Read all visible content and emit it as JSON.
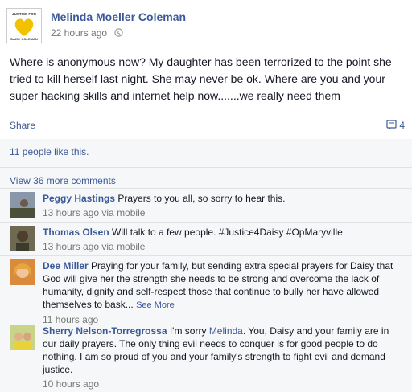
{
  "post": {
    "author": "Melinda Moeller Coleman",
    "avatar_text_top": "JUSTICE FOR",
    "avatar_text_bottom": "DAISY COLEMAN",
    "time": "22 hours ago",
    "text": "Where is anonymous now? My daughter has been terrorized to the point she tried to kill herself last night. She may never be ok. Where are you and your super hacking skills and internet help now.......we really need them",
    "audience_icon": "globe-icon"
  },
  "actions": {
    "share_label": "Share",
    "comment_count": "4",
    "comment_icon": "comment-icon"
  },
  "likes": {
    "text": "11 people like this."
  },
  "view_more": {
    "label": "View 36 more comments"
  },
  "comments": [
    {
      "name": "Peggy Hastings",
      "text": "Prayers to you all, so sorry to hear this.",
      "meta": "13 hours ago via mobile"
    },
    {
      "name": "Thomas Olsen",
      "text": "Will talk to a few people. #Justice4Daisy #OpMaryville",
      "meta": "13 hours ago via mobile"
    },
    {
      "name": "Dee Miller",
      "text": "Praying for your family, but sending extra special prayers for Daisy that God will give her the strength she needs to be strong and overcome the lack of humanity, dignity and self-respect those that continue to bully her have allowed themselves to bask...",
      "see_more": "See More",
      "meta": "11 hours ago"
    },
    {
      "name": "Sherry Nelson-Torregrossa",
      "text_before": "I'm sorry",
      "mention": "Melinda",
      "text_after": ". You, Daisy and your family are in our daily prayers. The only thing evil needs to conquer is for good people to do nothing. I am so proud of you and your family's strength to fight evil and demand justice.",
      "meta": "10 hours ago"
    }
  ],
  "colors": {
    "link": "#3b5998",
    "meta": "#777777",
    "feedback_bg": "#f6f7f8",
    "text": "#141823"
  }
}
